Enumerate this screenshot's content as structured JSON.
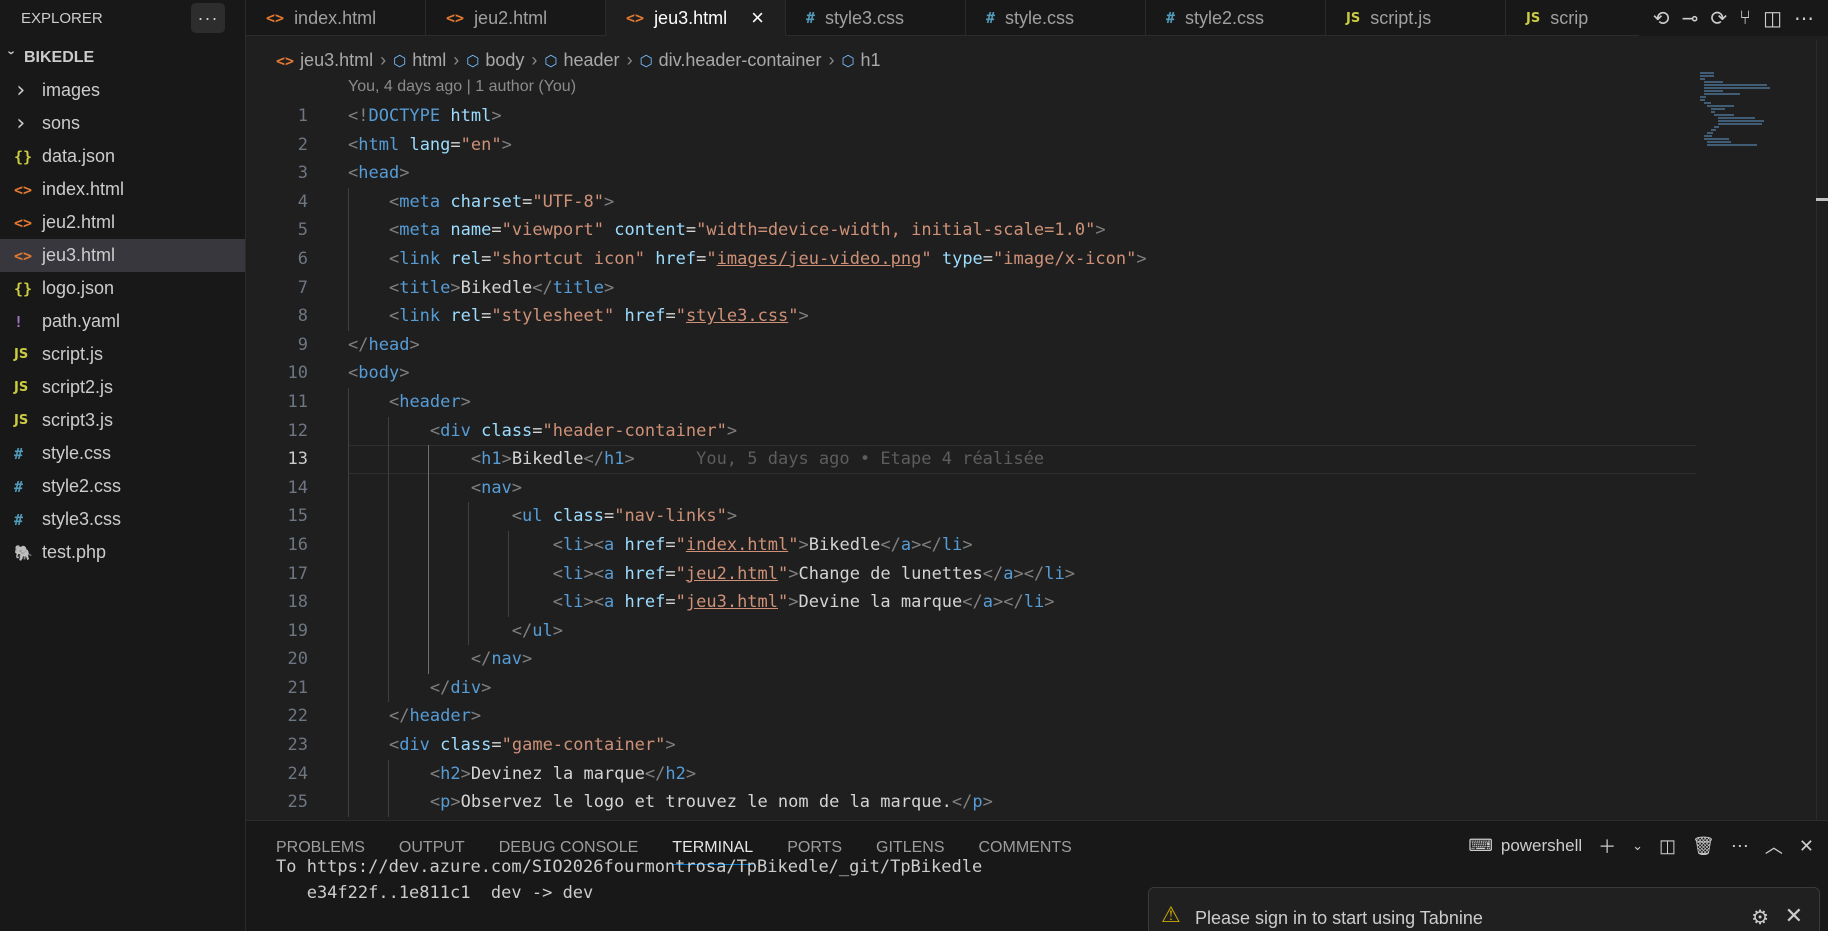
{
  "explorer": {
    "title": "EXPLORER",
    "more": "···",
    "root": "BIKEDLE",
    "items": [
      {
        "label": "images",
        "icon": "chevron-right",
        "type": "folder"
      },
      {
        "label": "sons",
        "icon": "chevron-right",
        "type": "folder"
      },
      {
        "label": "data.json",
        "icon": "{}",
        "type": "json"
      },
      {
        "label": "index.html",
        "icon": "<>",
        "type": "html"
      },
      {
        "label": "jeu2.html",
        "icon": "<>",
        "type": "html"
      },
      {
        "label": "jeu3.html",
        "icon": "<>",
        "type": "html",
        "active": true
      },
      {
        "label": "logo.json",
        "icon": "{}",
        "type": "json"
      },
      {
        "label": "path.yaml",
        "icon": "!",
        "type": "yaml"
      },
      {
        "label": "script.js",
        "icon": "JS",
        "type": "js"
      },
      {
        "label": "script2.js",
        "icon": "JS",
        "type": "js"
      },
      {
        "label": "script3.js",
        "icon": "JS",
        "type": "js"
      },
      {
        "label": "style.css",
        "icon": "#",
        "type": "css"
      },
      {
        "label": "style2.css",
        "icon": "#",
        "type": "css"
      },
      {
        "label": "style3.css",
        "icon": "#",
        "type": "css"
      },
      {
        "label": "test.php",
        "icon": "elephant",
        "type": "php"
      }
    ]
  },
  "tabs": [
    {
      "label": "index.html",
      "icon": "<>",
      "type": "html"
    },
    {
      "label": "jeu2.html",
      "icon": "<>",
      "type": "html"
    },
    {
      "label": "jeu3.html",
      "icon": "<>",
      "type": "html",
      "active": true
    },
    {
      "label": "style3.css",
      "icon": "#",
      "type": "css"
    },
    {
      "label": "style.css",
      "icon": "#",
      "type": "css"
    },
    {
      "label": "style2.css",
      "icon": "#",
      "type": "css"
    },
    {
      "label": "script.js",
      "icon": "JS",
      "type": "js"
    },
    {
      "label": "scrip",
      "icon": "JS",
      "type": "js"
    }
  ],
  "breadcrumb": [
    "jeu3.html",
    "html",
    "body",
    "header",
    "div.header-container",
    "h1"
  ],
  "blame_header": "You, 4 days ago | 1 author (You)",
  "current_line": 13,
  "inline_blame": "You, 5 days ago • Etape 4 réalisée",
  "code_lines": [
    "<!DOCTYPE html>",
    "<html lang=\"en\">",
    "<head>",
    "    <meta charset=\"UTF-8\">",
    "    <meta name=\"viewport\" content=\"width=device-width, initial-scale=1.0\">",
    "    <link rel=\"shortcut icon\" href=\"images/jeu-video.png\" type=\"image/x-icon\">",
    "    <title>Bikedle</title>",
    "    <link rel=\"stylesheet\" href=\"style3.css\">",
    "</head>",
    "<body>",
    "    <header>",
    "        <div class=\"header-container\">",
    "            <h1>Bikedle</h1>",
    "            <nav>",
    "                <ul class=\"nav-links\">",
    "                    <li><a href=\"index.html\">Bikedle</a></li>",
    "                    <li><a href=\"jeu2.html\">Change de lunettes</a></li>",
    "                    <li><a href=\"jeu3.html\">Devine la marque</a></li>",
    "                </ul>",
    "            </nav>",
    "        </div>",
    "    </header>",
    "    <div class=\"game-container\">",
    "        <h2>Devinez la marque</h2>",
    "        <p>Observez le logo et trouvez le nom de la marque.</p>"
  ],
  "link_values": [
    "images/jeu-video.png",
    "style3.css",
    "index.html",
    "jeu2.html",
    "jeu3.html"
  ],
  "panel": {
    "tabs": [
      "PROBLEMS",
      "OUTPUT",
      "DEBUG CONSOLE",
      "TERMINAL",
      "PORTS",
      "GITLENS",
      "COMMENTS"
    ],
    "active_tab": "TERMINAL",
    "shell": "powershell",
    "terminal_lines": [
      "To https://dev.azure.com/SIO2026fourmontrosa/TpBikedle/_git/TpBikedle",
      "   e34f22f..1e811c1  dev -> dev"
    ]
  },
  "notification": {
    "message": "Please sign in to start using Tabnine"
  },
  "colors": {
    "tag": "#569cd6",
    "attr": "#9cdcfe",
    "string": "#ce9178",
    "accent": "#0078d4"
  }
}
